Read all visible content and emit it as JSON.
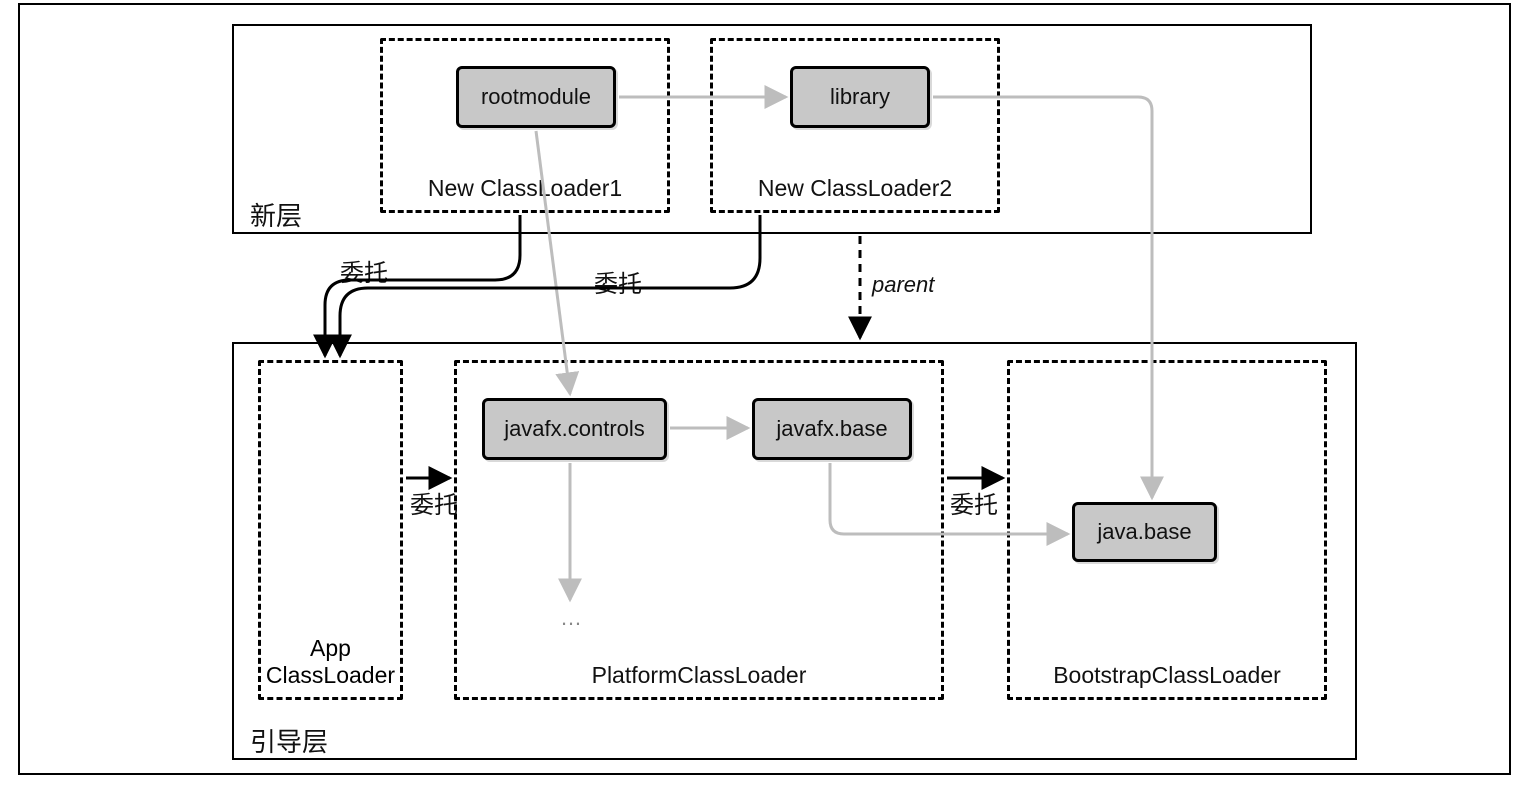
{
  "diagram": {
    "layers": {
      "new": {
        "label": "新层"
      },
      "boot": {
        "label": "引导层"
      }
    },
    "loaders": {
      "new1": {
        "label": "New ClassLoader1"
      },
      "new2": {
        "label": "New ClassLoader2"
      },
      "app": {
        "label1": "App",
        "label2": "ClassLoader"
      },
      "platform": {
        "label": "PlatformClassLoader"
      },
      "bootstrap": {
        "label": "BootstrapClassLoader"
      }
    },
    "modules": {
      "rootmodule": "rootmodule",
      "library": "library",
      "javafx_controls": "javafx.controls",
      "javafx_base": "javafx.base",
      "java_base": "java.base",
      "ellipsis": "…"
    },
    "edges": {
      "delegate": "委托",
      "parent": "parent"
    }
  }
}
